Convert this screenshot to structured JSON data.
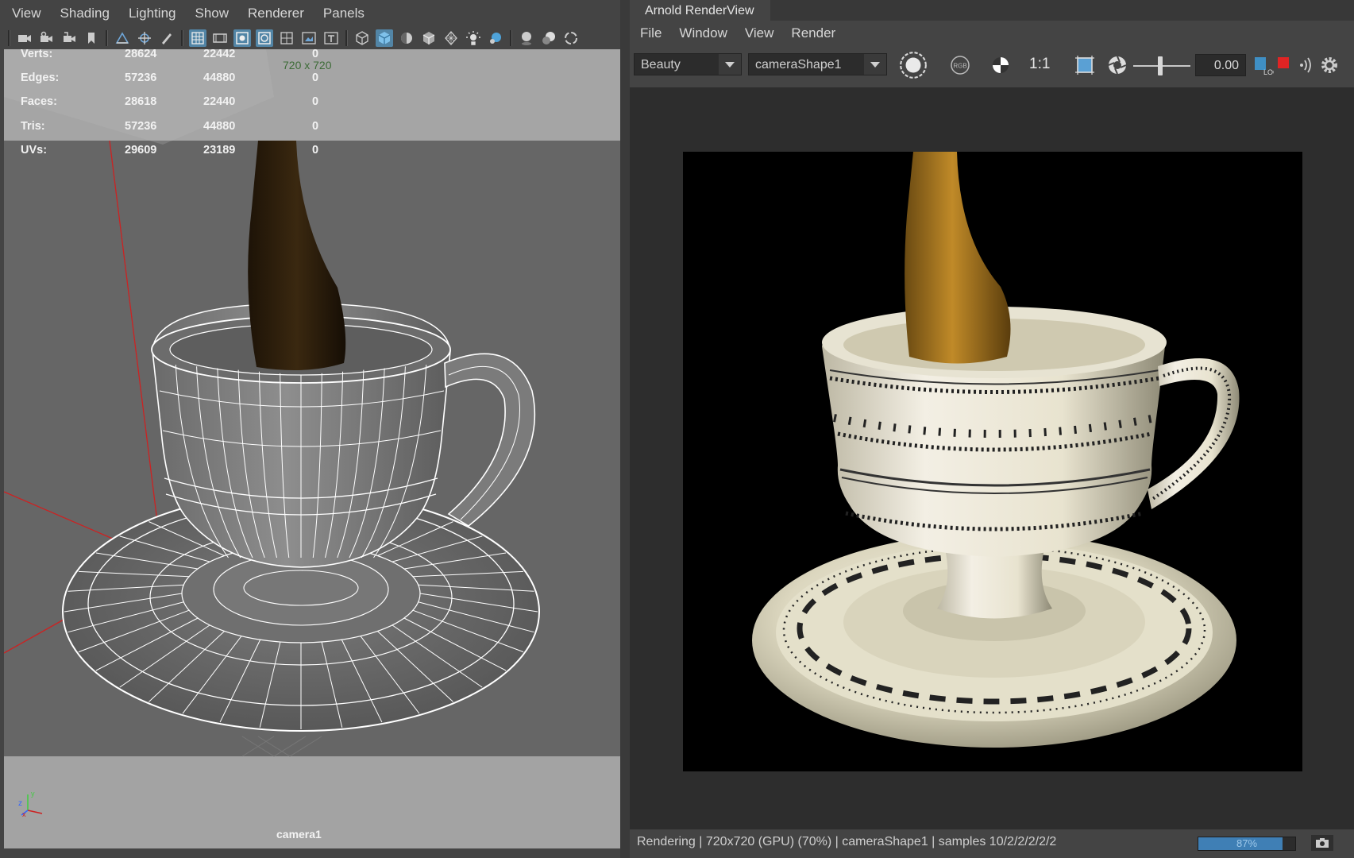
{
  "viewport": {
    "menu": [
      "View",
      "Shading",
      "Lighting",
      "Show",
      "Renderer",
      "Panels"
    ],
    "toolbar_icons": [
      "camera-select-icon",
      "camera-attributes-icon",
      "bookmarks-icon",
      "bookmark-icon",
      "image-plane-icon",
      "two-d-pan-icon",
      "grease-pencil-icon",
      "grid-icon",
      "film-gate-icon",
      "resolution-gate-icon",
      "gate-mask-icon",
      "field-chart-icon",
      "safe-action-icon",
      "safe-title-icon",
      "wireframe-icon",
      "smooth-shade-icon",
      "use-default-material-icon",
      "wireframe-on-shaded-icon",
      "xray-icon",
      "use-all-lights-icon",
      "isolate-select-icon",
      "shadows-icon",
      "screen-space-ao-icon",
      "motion-blur-icon"
    ],
    "resolution_label": "720 x 720",
    "hud_rows": [
      {
        "label": "Verts:",
        "a": "28624",
        "b": "22442",
        "c": "0"
      },
      {
        "label": "Edges:",
        "a": "57236",
        "b": "44880",
        "c": "0"
      },
      {
        "label": "Faces:",
        "a": "28618",
        "b": "22440",
        "c": "0"
      },
      {
        "label": "Tris:",
        "a": "57236",
        "b": "44880",
        "c": "0"
      },
      {
        "label": "UVs:",
        "a": "29609",
        "b": "23189",
        "c": "0"
      }
    ],
    "camera_label": "camera1",
    "axis": {
      "z": "z",
      "x": "x",
      "y": "y"
    }
  },
  "renderview": {
    "title": "Arnold RenderView",
    "menu": [
      "File",
      "Window",
      "View",
      "Render"
    ],
    "aov": "Beauty",
    "camera": "cameraShape1",
    "ratio": "1:1",
    "exposure": "0.00",
    "status": "Rendering | 720x720 (GPU) (70%) | cameraShape1 | samples 10/2/2/2/2/2",
    "progress_label": "87%",
    "progress": 0.87
  },
  "colors": {
    "accent": "#5285a6",
    "progress": "#3f7fb5",
    "axis_x": "#cc2222",
    "axis_y": "#44cc44",
    "axis_z": "#3366ff"
  }
}
